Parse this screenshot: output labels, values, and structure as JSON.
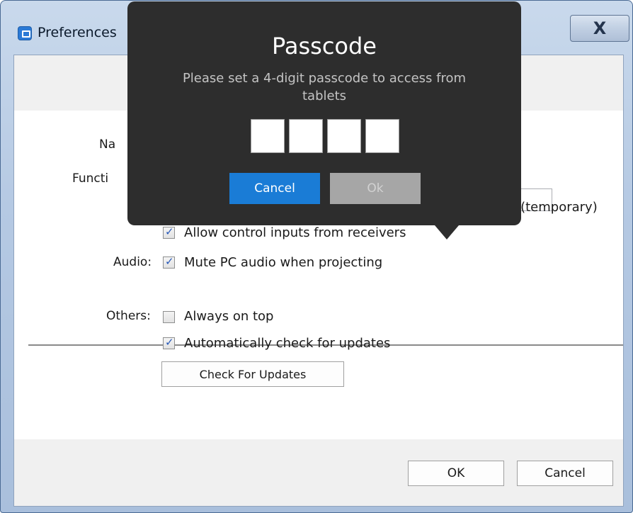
{
  "window": {
    "title": "Preferences",
    "close_label": "X"
  },
  "settings": {
    "name_label": "Na",
    "function_label": "Functi",
    "partial_option_text": "s (temporary)",
    "allow_control": {
      "label": "Allow control inputs from receivers",
      "checked": true
    },
    "audio_label": "Audio:",
    "mute_audio": {
      "label": "Mute PC audio when projecting",
      "checked": true
    },
    "others_label": "Others:",
    "always_on_top": {
      "label": "Always on top",
      "checked": false
    },
    "auto_update": {
      "label": "Automatically check for updates",
      "checked": true
    },
    "check_updates_button": "Check For Updates"
  },
  "footer": {
    "ok_label": "OK",
    "cancel_label": "Cancel"
  },
  "passcode_popup": {
    "title": "Passcode",
    "description": "Please set a 4-digit passcode to access from tablets",
    "digits": [
      "",
      "",
      "",
      ""
    ],
    "cancel_label": "Cancel",
    "ok_label": "Ok"
  },
  "colors": {
    "popup_background": "#2d2d2d",
    "cancel_button": "#1a7cd6",
    "ok_button_disabled": "#a6a6a6"
  }
}
